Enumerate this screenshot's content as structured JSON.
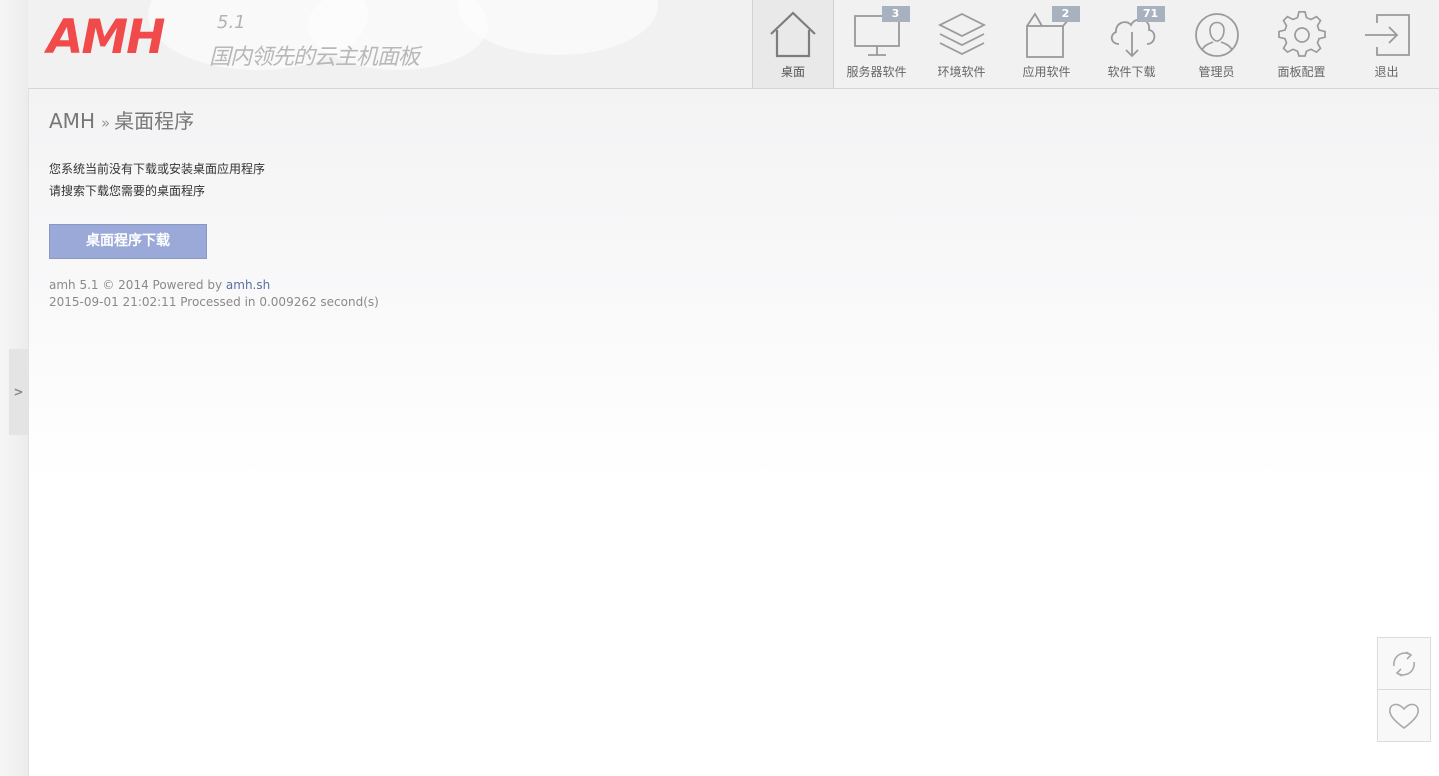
{
  "brand": {
    "logo_text": "AMH",
    "version": "5.1",
    "slogan": "国内领先的云主机面板"
  },
  "nav": {
    "items": [
      {
        "label": "桌面",
        "icon": "home-icon",
        "active": true
      },
      {
        "label": "服务器软件",
        "icon": "monitor-icon",
        "badge": "3"
      },
      {
        "label": "环境软件",
        "icon": "layers-icon"
      },
      {
        "label": "应用软件",
        "icon": "box-icon",
        "badge": "2"
      },
      {
        "label": "软件下载",
        "icon": "cloud-download-icon",
        "badge": "71"
      },
      {
        "label": "管理员",
        "icon": "user-icon"
      },
      {
        "label": "面板配置",
        "icon": "gear-icon"
      },
      {
        "label": "退出",
        "icon": "exit-icon"
      }
    ]
  },
  "breadcrumb": {
    "root": "AMH",
    "separator": "»",
    "current": "桌面程序"
  },
  "main": {
    "message_line1": "您系统当前没有下载或安装桌面应用程序",
    "message_line2": "请搜索下载您需要的桌面程序",
    "download_button": "桌面程序下载"
  },
  "footer": {
    "prefix": "amh 5.1 © 2014 Powered by ",
    "link_text": "amh.sh",
    "processed": "2015-09-01 21:02:11 Processed in 0.009262 second(s)"
  },
  "sidebar": {
    "toggle_label": ">"
  },
  "colors": {
    "brand_red": "#f04a4a",
    "button_blue": "#9aa9d8",
    "badge_gray": "#a8b2bf"
  }
}
